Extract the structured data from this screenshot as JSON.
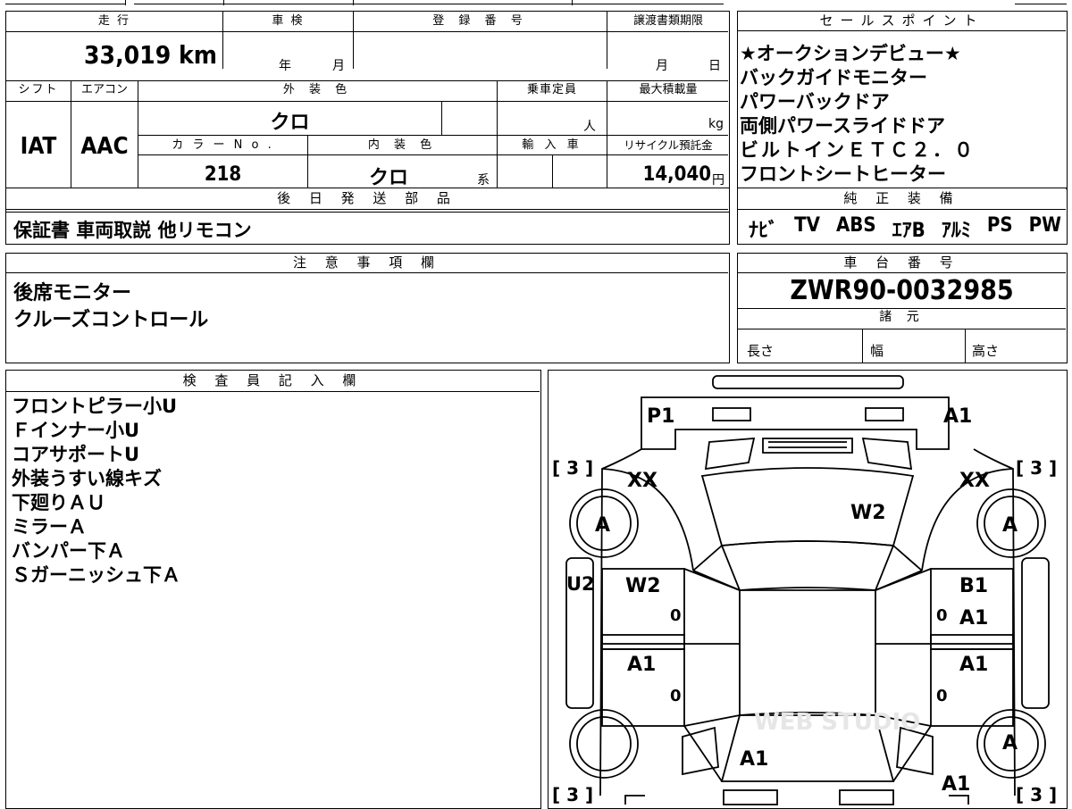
{
  "sheet": {
    "mileage": {
      "label": "走 行",
      "value": "33,019 km"
    },
    "inspection": {
      "label": "車 検",
      "year_unit": "年",
      "month_unit": "月"
    },
    "registration": {
      "label": "登 録 番 号"
    },
    "transfer_deadline": {
      "label": "譲渡書類期限",
      "month_unit": "月",
      "day_unit": "日"
    },
    "shift": {
      "label": "シフト",
      "value": "IAT"
    },
    "aircon": {
      "label": "エアコン",
      "value": "AAC"
    },
    "exterior_color": {
      "label": "外 装 色",
      "value": "クロ"
    },
    "capacity": {
      "label": "乗車定員",
      "unit": "人"
    },
    "max_load": {
      "label": "最大積載量",
      "unit": "kg"
    },
    "color_no": {
      "label": "カ ラ ー N o .",
      "value": "218"
    },
    "interior_color": {
      "label": "内 装 色",
      "value": "クロ",
      "unit": "系"
    },
    "import": {
      "label": "輸 入 車"
    },
    "recycle": {
      "label": "リサイクル預託金",
      "value": "14,040",
      "unit": "円"
    },
    "later_parts": {
      "label": "後 日 発 送 部 品",
      "value": "保証書 車両取説 他リモコン"
    },
    "sales_points": {
      "label": "セールスポイント",
      "items": [
        "★オークションデビュー★",
        "バックガイドモニター",
        "パワーバックドア",
        "両側パワースライドドア",
        "ビルトインＥＴＣ２．０",
        "フロントシートヒーター"
      ]
    },
    "genuine_equipment": {
      "label": "純 正 装 備",
      "items": [
        "ﾅﾋﾞ",
        "TV",
        "ABS",
        "ｴｱB",
        "ｱﾙﾐ",
        "PS",
        "PW"
      ]
    },
    "notes": {
      "label": "注 意 事 項 欄",
      "items": [
        "後席モニター",
        "クルーズコントロール"
      ]
    },
    "chassis": {
      "label": "車 台 番 号",
      "value": "ZWR90-0032985"
    },
    "specs": {
      "label": "諸 元",
      "length": "長さ",
      "width": "幅",
      "height": "高さ"
    },
    "inspector": {
      "label": "検 査 員 記 入 欄",
      "items": [
        "フロントピラー小U",
        "Ｆインナー小U",
        "コアサポートU",
        "外装うすい線キズ",
        "下廻りＡＵ",
        "ミラーＡ",
        "バンパー下Ａ",
        "Ｓガーニッシュ下Ａ"
      ]
    },
    "diagram": {
      "codes": {
        "front_left": "P1",
        "front_right": "A1",
        "tire_fl": "[ 3 ]",
        "tire_fr": "[ 3 ]",
        "tire_rl": "[ 3 ]",
        "tire_rr": "[ 3 ]",
        "fender_fl": "XX",
        "fender_fr": "XX",
        "hood": "W2",
        "wheel_fl": "A",
        "wheel_fr": "A",
        "wheel_rr": "A",
        "sill_left": "U2",
        "door_fl": "W2",
        "door_fr": "B1",
        "door_fr2": "A1",
        "door_rl": "A1",
        "door_rr": "A1",
        "rear": "A1",
        "rear_right": "A1",
        "zero": "0"
      },
      "watermark": "WEB STUDIO"
    }
  }
}
